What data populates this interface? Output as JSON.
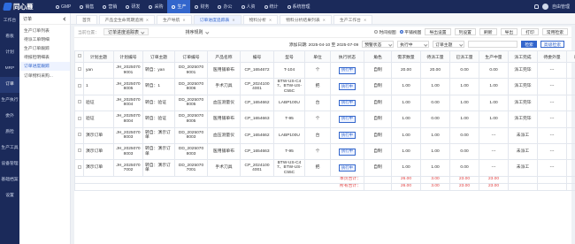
{
  "app": {
    "logo": "同心雁"
  },
  "nav": [
    {
      "label": "GMP",
      "active": false
    },
    {
      "label": "销售",
      "active": false
    },
    {
      "label": "营销",
      "active": false
    },
    {
      "label": "研发",
      "active": false
    },
    {
      "label": "采购",
      "active": false
    },
    {
      "label": "生产",
      "active": true
    },
    {
      "label": "财务",
      "active": false
    },
    {
      "label": "办公",
      "active": false
    },
    {
      "label": "人资",
      "active": false
    },
    {
      "label": "统计",
      "active": false
    },
    {
      "label": "系统管理",
      "active": false
    }
  ],
  "user": {
    "name": "自由管理"
  },
  "sidebar": [
    {
      "label": "工作台",
      "active": false
    },
    {
      "label": "看板",
      "active": false
    },
    {
      "label": "计划",
      "active": false
    },
    {
      "label": "MRP",
      "active": false
    },
    {
      "label": "订单",
      "active": true
    },
    {
      "label": "生产执行",
      "active": false
    },
    {
      "label": "委外",
      "active": false
    },
    {
      "label": "质检",
      "active": false
    },
    {
      "label": "生产工具",
      "active": false
    },
    {
      "label": "设备管理",
      "active": false
    },
    {
      "label": "基础档案",
      "active": false
    },
    {
      "label": "设置",
      "active": false
    }
  ],
  "subnav": {
    "title": "订单",
    "items": [
      {
        "label": "生产订单列表",
        "active": false
      },
      {
        "label": "待派工单明细",
        "active": false
      },
      {
        "label": "生产订单跟踪",
        "active": false
      },
      {
        "label": "待报检明细表",
        "active": false
      },
      {
        "label": "订单进度跟踪",
        "active": true
      },
      {
        "label": "订单物料采购...",
        "active": false
      }
    ]
  },
  "tabs": [
    {
      "label": "首页",
      "active": false
    },
    {
      "label": "产品全生命周期追溯",
      "active": false
    },
    {
      "label": "生产导航",
      "active": false
    },
    {
      "label": "订单进度追踪表",
      "active": true
    },
    {
      "label": "物料分析",
      "active": false
    },
    {
      "label": "物料分析结果列表",
      "active": false
    },
    {
      "label": "生产工作台",
      "active": false
    }
  ],
  "toolbar": {
    "crumb": "当前位置：",
    "view_select": "订单进度追踪表",
    "sort_label": "排序规则",
    "radio_time": "时间视图",
    "radio_tile": "平铺视图",
    "btn_import": "导出设置",
    "btn_columns": "列设置",
    "btn_refresh": "刷新",
    "btn_export": "导出",
    "btn_print": "打印",
    "btn_favorites": "常用检索"
  },
  "filters": {
    "date_range": "添加日期: 2025-04-10 至 2025-07-09",
    "warn_status": "预警状态",
    "exec_status": "执行中",
    "order_type": "订单主题",
    "search_placeholder": "",
    "search_btn": "检索",
    "advanced_btn": "高级检索"
  },
  "table": {
    "headers": [
      "计划主题",
      "计划编号",
      "订单主题",
      "订单编号",
      "产品名称",
      "编号",
      "型号",
      "单位",
      "执行状态",
      "角色",
      "需求数量",
      "待派工量",
      "已派工量",
      "生产中量",
      "派工完成",
      "待委外量",
      "已委外量"
    ],
    "rows": [
      [
        "yan",
        "JH_2025070 9001",
        "转自：yan",
        "DD_2025070 9001",
        "医用铺单布",
        "CP_1654672",
        "T-104",
        "个",
        "执行中",
        "自制",
        "20.00",
        "20.00",
        "0.00",
        "0.00",
        "派工完毕",
        "---",
        "---"
      ],
      [
        "1",
        "JH_2025070 8005",
        "转自：1",
        "DD_2025070 8006",
        "手术刀具",
        "CP_2024100 4001",
        "BTW-US-C4 7、BTW-US- C55C",
        "把",
        "执行中",
        "自制",
        "1.00",
        "1.00",
        "1.00",
        "1.00",
        "派工完毕",
        "---",
        "---"
      ],
      [
        "验证",
        "JH_2025070 8004",
        "转自：验证",
        "DD_2025070 8005",
        "血压测量仪",
        "CP_1654662",
        "LABP100U",
        "台",
        "执行中",
        "自制",
        "1.00",
        "0.00",
        "1.00",
        "1.00",
        "派工完毕",
        "---",
        "---"
      ],
      [
        "验证",
        "JH_2025070 8004",
        "转自：验证",
        "DD_2025070 8005",
        "医用铺单布",
        "CP_1654663",
        "T-95",
        "个",
        "执行中",
        "自制",
        "1.00",
        "0.00",
        "1.00",
        "1.00",
        "派工完毕",
        "---",
        "---"
      ],
      [
        "演示订单",
        "JH_2025070 8003",
        "转自：演示订 单",
        "DD_2025070 8003",
        "血压测量仪",
        "CP_1654662",
        "LABP100U",
        "台",
        "执行中",
        "自制",
        "1.00",
        "1.00",
        "0.00",
        "---",
        "未派工",
        "---",
        "---"
      ],
      [
        "演示订单",
        "JH_2025070 8003",
        "转自：演示订 单",
        "DD_2025070 8003",
        "医用铺单布",
        "CP_1654663",
        "T-95",
        "个",
        "执行中",
        "自制",
        "1.00",
        "1.00",
        "0.00",
        "---",
        "未派工",
        "---",
        "---"
      ],
      [
        "演示订单",
        "JH_2025070 7002",
        "转自：演示订 单",
        "DD_2025070 7001",
        "手术刀具",
        "CP_2024100 4001",
        "BTW-US-C4 7、BTW-US- C55C",
        "把",
        "执行中",
        "自制",
        "1.00",
        "1.00",
        "0.00",
        "---",
        "未派工",
        "---",
        "---"
      ]
    ],
    "summary": [
      {
        "label": "本页合计：",
        "values": [
          "26.00",
          "3.00",
          "23.00",
          "23.00"
        ]
      },
      {
        "label": "所有合计：",
        "values": [
          "26.00",
          "3.00",
          "23.00",
          "23.00"
        ]
      }
    ]
  }
}
